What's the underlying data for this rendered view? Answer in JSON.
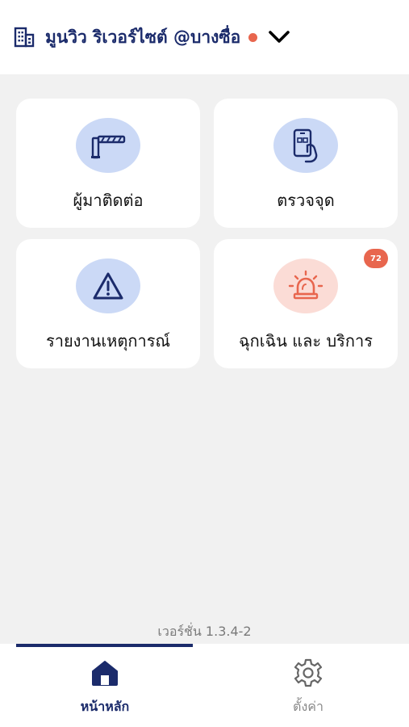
{
  "header": {
    "site_name": "มูนวิว ริเวอร์ไซต์ @บางซื่อ",
    "icons": [
      "building-icon",
      "chevron-down-icon"
    ],
    "status_color": "#e8664e",
    "accent_color": "#1b2b6b"
  },
  "menu": [
    {
      "label": "ผู้มาติดต่อ",
      "icon": "barrier-gate-icon",
      "circle_color": "#cbd9f6"
    },
    {
      "label": "ตรวจจุด",
      "icon": "phone-scan-icon",
      "circle_color": "#cbd9f6"
    },
    {
      "label": "รายงานเหตุการณ์",
      "icon": "warning-icon",
      "circle_color": "#cbd9f6"
    },
    {
      "label": "ฉุกเฉิน และ บริการ",
      "icon": "siren-icon",
      "circle_color": "#fbdcd6",
      "badge": "72"
    }
  ],
  "version": "เวอร์ชั่น 1.3.4-2",
  "bottom_nav": {
    "home_label": "หน้าหลัก",
    "settings_label": "ตั้งค่า",
    "active": "home"
  }
}
